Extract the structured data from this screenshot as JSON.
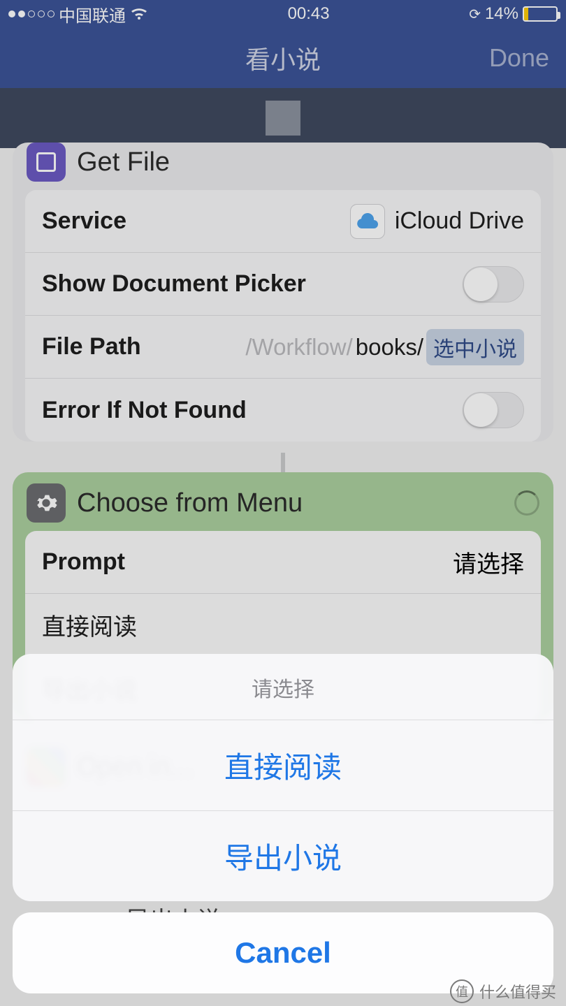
{
  "status": {
    "carrier": "中国联通",
    "time": "00:43",
    "battery_pct": "14%"
  },
  "nav": {
    "title": "看小说",
    "done": "Done"
  },
  "getfile": {
    "title": "Get File",
    "rows": {
      "service_label": "Service",
      "service_value": "iCloud Drive",
      "picker_label": "Show Document Picker",
      "path_label": "File Path",
      "path_prefix": "/Workflow/",
      "path_mid": "books/",
      "path_token": "选中小说",
      "error_label": "Error If Not Found"
    }
  },
  "menu": {
    "title": "Choose from Menu",
    "prompt_label": "Prompt",
    "prompt_value": "请选择",
    "items": [
      "直接阅读",
      "导出小说"
    ]
  },
  "openin": {
    "label": "Open in..."
  },
  "peek_text": "导出小说",
  "sheet": {
    "title": "请选择",
    "options": [
      "直接阅读",
      "导出小说"
    ],
    "cancel": "Cancel"
  },
  "watermark": {
    "glyph": "值",
    "text": "什么值得买"
  }
}
